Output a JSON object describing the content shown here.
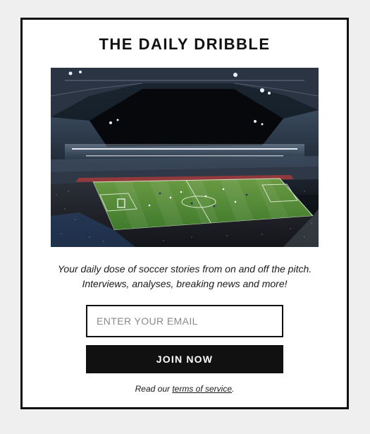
{
  "newsletter": {
    "title": "THE DAILY DRIBBLE",
    "tagline_line1": "Your daily dose of soccer stories from on and off the pitch.",
    "tagline_line2": "Interviews, analyses, breaking news and more!",
    "email_placeholder": "ENTER YOUR EMAIL",
    "email_value": "",
    "join_label": "JOIN NOW",
    "terms_prefix": "Read our ",
    "terms_link": "terms of service",
    "terms_suffix": "."
  },
  "colors": {
    "page_background": "#efefef",
    "card_background": "#ffffff",
    "border": "#111111",
    "button_background": "#111111",
    "button_text": "#ffffff",
    "pitch": "#4f8a3a"
  },
  "icons": {
    "hero_image": "stadium-photo"
  }
}
